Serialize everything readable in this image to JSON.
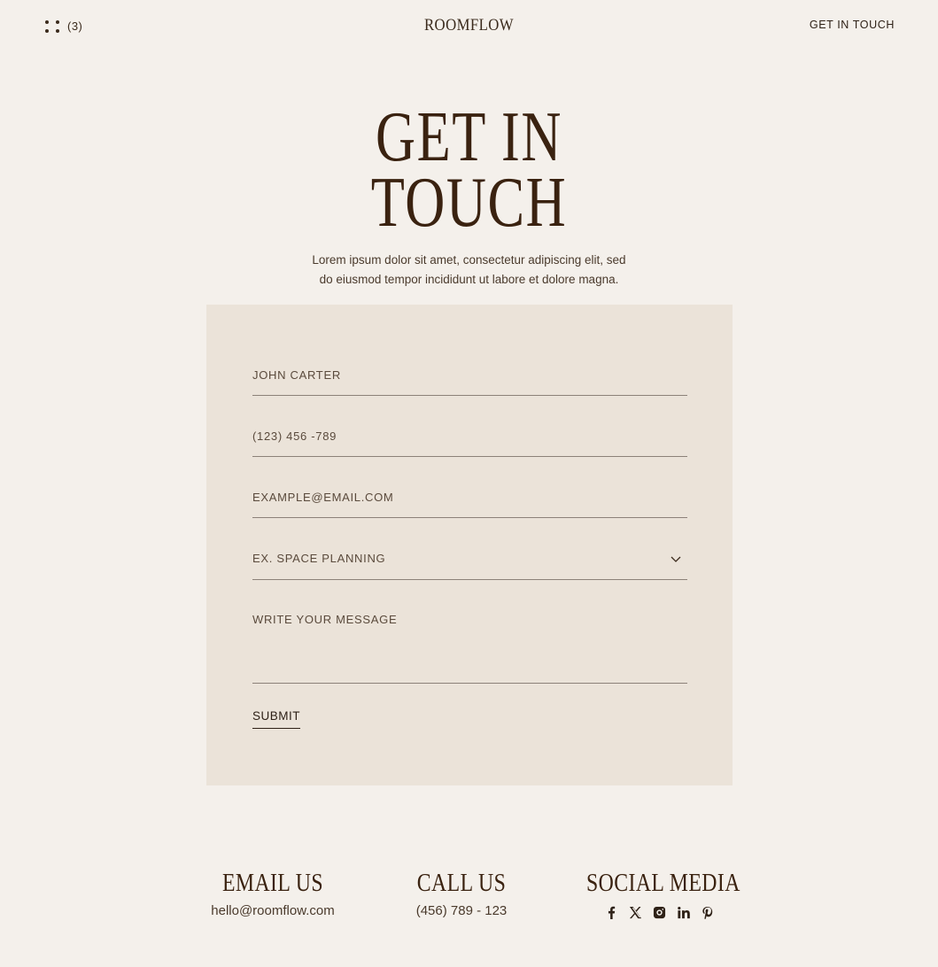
{
  "header": {
    "cart_count": "(3)",
    "logo": "ROOMFLOW",
    "cta_label": "GET IN TOUCH"
  },
  "hero": {
    "title_line1": "GET IN",
    "title_line2": "TOUCH",
    "subtitle_line1": "Lorem ipsum dolor sit amet, consectetur adipiscing elit, sed",
    "subtitle_line2": "do eiusmod tempor incididunt ut labore et dolore magna."
  },
  "form": {
    "name_placeholder": "JOHN CARTER",
    "phone_placeholder": "(123) 456 -789",
    "email_placeholder": "EXAMPLE@EMAIL.COM",
    "service_selected": "EX. SPACE PLANNING",
    "message_placeholder": "WRITE YOUR MESSAGE",
    "submit_label": "SUBMIT"
  },
  "contacts": {
    "email_heading": "EMAIL US",
    "email_value": "hello@roomflow.com",
    "call_heading": "CALL US",
    "call_value": "(456) 789 - 123",
    "social_heading": "SOCIAL MEDIA",
    "social_icons": [
      "facebook-icon",
      "x-icon",
      "instagram-icon",
      "linkedin-icon",
      "pinterest-icon"
    ]
  },
  "colors": {
    "background": "#f4f0eb",
    "card": "#ebe3d9",
    "text_dark": "#3a2210",
    "divider": "#8c8179"
  }
}
